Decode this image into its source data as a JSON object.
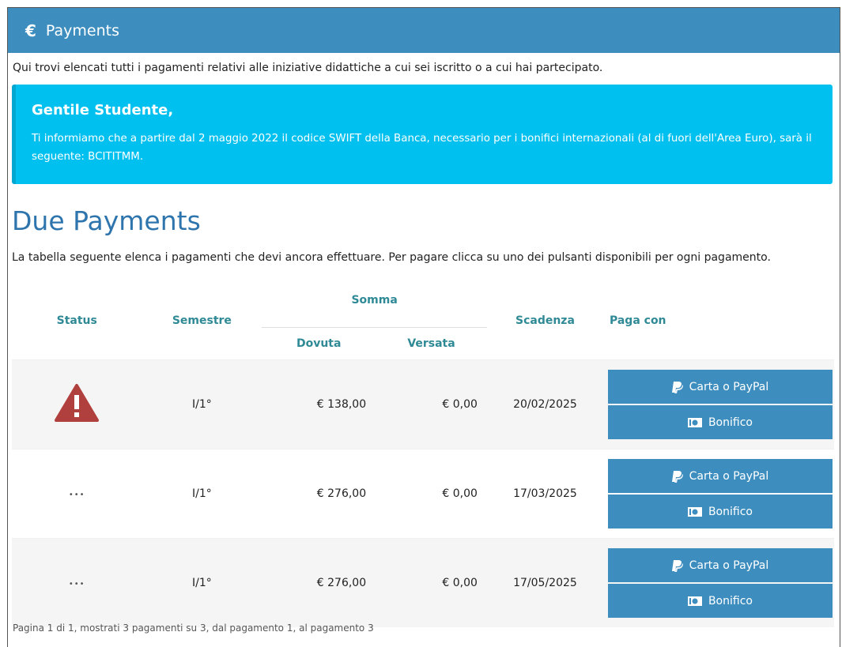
{
  "panel": {
    "icon": "euro-icon",
    "symbol": "€",
    "title": "Payments"
  },
  "intro": "Qui trovi elencati tutti i pagamenti relativi alle iniziative didattiche a cui sei iscritto o a cui hai partecipato.",
  "callout": {
    "title": "Gentile Studente,",
    "text": "Ti informiamo che a partire dal 2 maggio 2022 il codice SWIFT della Banca, necessario per i bonifici internazionali (al di fuori dell'Area Euro), sarà il seguente: BCITITMM."
  },
  "section": {
    "title": "Due Payments",
    "description": "La tabella seguente elenca i pagamenti che devi ancora effettuare. Per pagare clicca su uno dei pulsanti disponibili per ogni pagamento."
  },
  "table": {
    "headers": {
      "status": "Status",
      "semestre": "Semestre",
      "somma": "Somma",
      "dovuta": "Dovuta",
      "versata": "Versata",
      "scadenza": "Scadenza",
      "paga_con": "Paga con"
    },
    "rows": [
      {
        "status": "warning",
        "status_text": "",
        "semestre": "I/1°",
        "dovuta": "€ 138,00",
        "versata": "€ 0,00",
        "scadenza": "20/02/2025",
        "btn_card": "Carta o PayPal",
        "btn_bonifico": "Bonifico"
      },
      {
        "status": "pending",
        "status_text": "•••",
        "semestre": "I/1°",
        "dovuta": "€ 276,00",
        "versata": "€ 0,00",
        "scadenza": "17/03/2025",
        "btn_card": "Carta o PayPal",
        "btn_bonifico": "Bonifico"
      },
      {
        "status": "pending",
        "status_text": "•••",
        "semestre": "I/1°",
        "dovuta": "€ 276,00",
        "versata": "€ 0,00",
        "scadenza": "17/05/2025",
        "btn_card": "Carta o PayPal",
        "btn_bonifico": "Bonifico"
      }
    ]
  },
  "footer": "Pagina 1 di 1, mostrati 3 pagamenti su 3, dal pagamento 1, al pagamento 3",
  "colors": {
    "header": "#3d8ebf",
    "callout": "#00c0ef",
    "title": "#2f75ad",
    "table_header": "#2f8a96",
    "warning": "#b0403d"
  }
}
